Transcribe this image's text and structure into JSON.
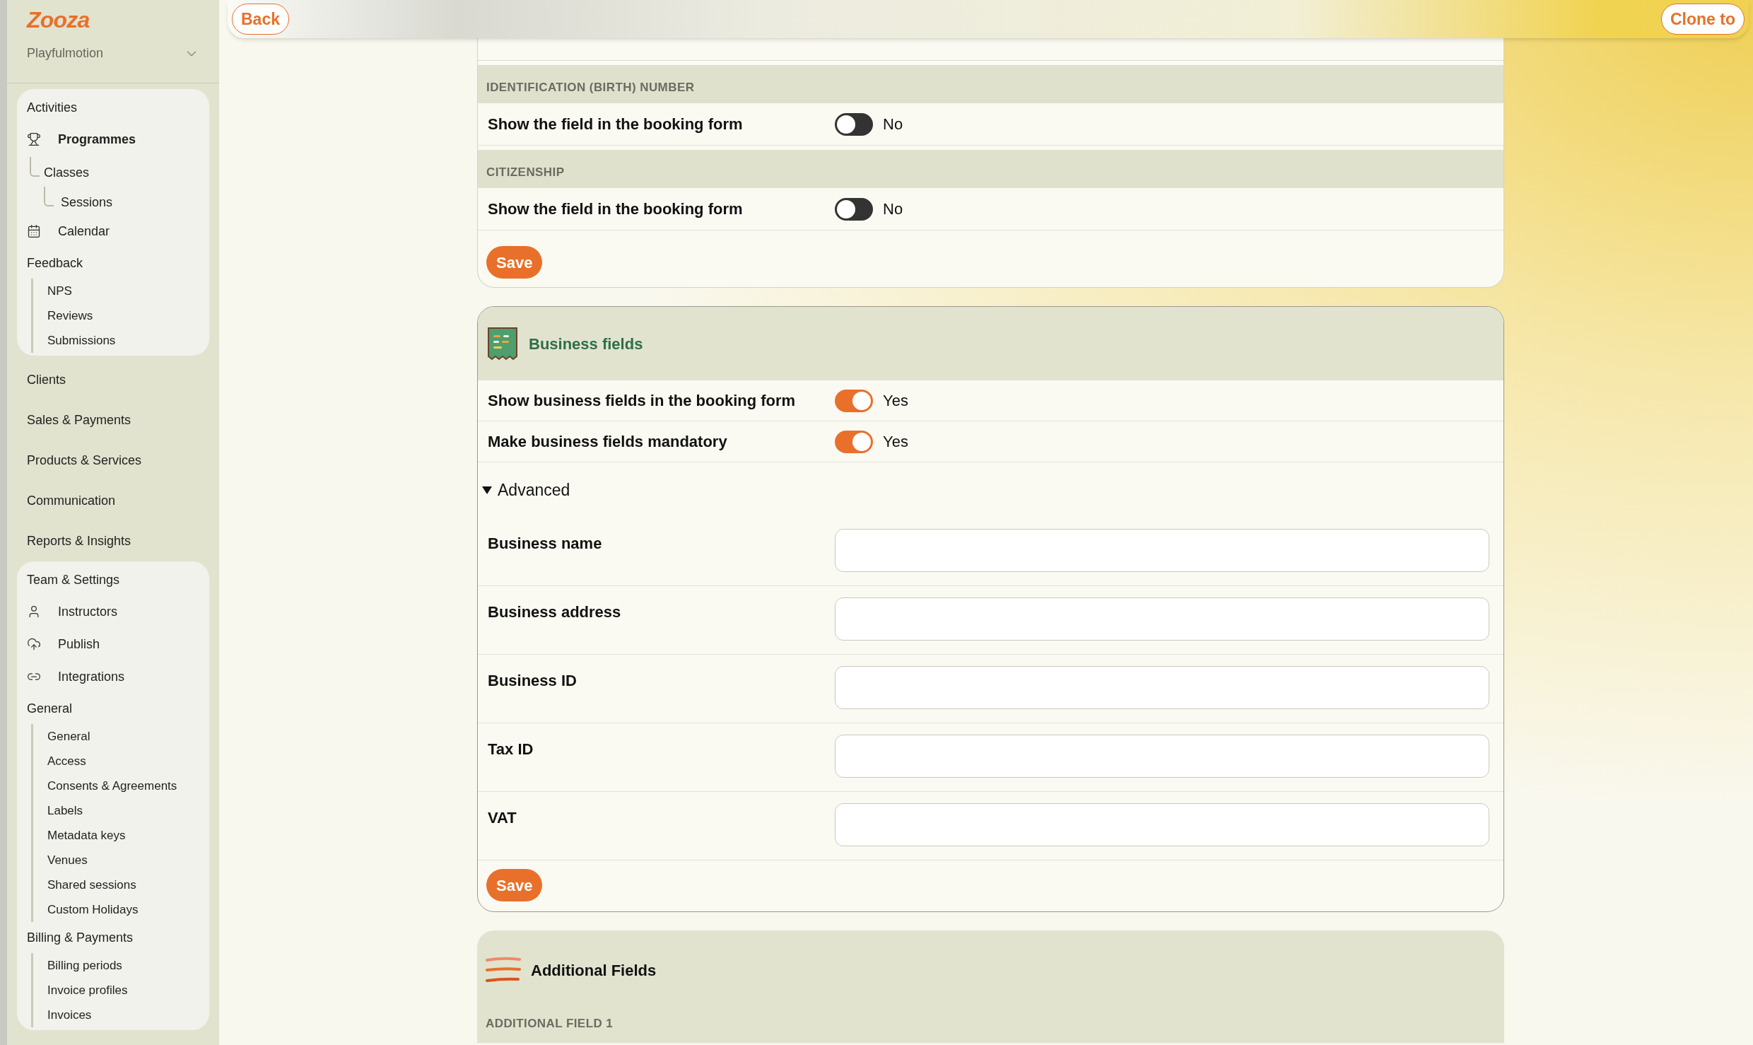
{
  "top_bar": {
    "back": "Back",
    "clone": "Clone to"
  },
  "sidebar": {
    "logo": "Zooza",
    "account": "Playfulmotion",
    "sections": [
      {
        "kind": "card",
        "items": [
          {
            "kind": "heading",
            "label": "Activities"
          },
          {
            "kind": "link",
            "label": "Programmes",
            "selected": true,
            "children": [
              {
                "label": "Classes",
                "children": [
                  {
                    "label": "Sessions"
                  }
                ]
              }
            ]
          },
          {
            "kind": "link",
            "label": "Calendar",
            "selected": false
          },
          {
            "kind": "group",
            "label": "Feedback",
            "children": [
              {
                "label": "NPS"
              },
              {
                "label": "Reviews"
              },
              {
                "label": "Submissions"
              }
            ]
          }
        ]
      },
      {
        "kind": "top",
        "label": "Clients"
      },
      {
        "kind": "top",
        "label": "Sales & Payments"
      },
      {
        "kind": "top",
        "label": "Products & Services"
      },
      {
        "kind": "top",
        "label": "Communication"
      },
      {
        "kind": "top",
        "label": "Reports & Insights"
      },
      {
        "kind": "card",
        "items": [
          {
            "kind": "heading",
            "label": "Team & Settings"
          },
          {
            "kind": "link",
            "label": "Instructors",
            "selected": false
          },
          {
            "kind": "link",
            "label": "Publish",
            "selected": false
          },
          {
            "kind": "link",
            "label": "Integrations",
            "selected": false
          },
          {
            "kind": "group",
            "label": "General",
            "children": [
              {
                "label": "General"
              },
              {
                "label": "Access"
              },
              {
                "label": "Consents & Agreements"
              },
              {
                "label": "Labels"
              },
              {
                "label": "Metadata keys"
              },
              {
                "label": "Venues"
              },
              {
                "label": "Shared sessions"
              },
              {
                "label": "Custom Holidays"
              }
            ]
          },
          {
            "kind": "group",
            "label": "Billing & Payments",
            "children": [
              {
                "label": "Billing periods"
              },
              {
                "label": "Invoice profiles"
              },
              {
                "label": "Invoices"
              }
            ]
          }
        ]
      }
    ]
  },
  "booking_fields_card": {
    "sections": [
      {
        "heading": "IDENTIFICATION (BIRTH) NUMBER",
        "label": "Show the field in the booking form",
        "on": false,
        "value": "No"
      },
      {
        "heading": "CITIZENSHIP",
        "label": "Show the field in the booking form",
        "on": false,
        "value": "No"
      }
    ],
    "save": "Save"
  },
  "business_fields_card": {
    "title": "Business fields",
    "toggles": [
      {
        "label": "Show business fields in the booking form",
        "on": true,
        "value": "Yes"
      },
      {
        "label": "Make business fields mandatory",
        "on": true,
        "value": "Yes"
      }
    ],
    "advanced": {
      "label": "Advanced",
      "expanded": true
    },
    "fields": [
      {
        "label": "Business name"
      },
      {
        "label": "Business address"
      },
      {
        "label": "Business ID"
      },
      {
        "label": "Tax ID"
      },
      {
        "label": "VAT"
      }
    ],
    "save": "Save"
  },
  "additional_fields_card": {
    "title": "Additional Fields",
    "section_heading": "ADDITIONAL FIELD 1"
  }
}
